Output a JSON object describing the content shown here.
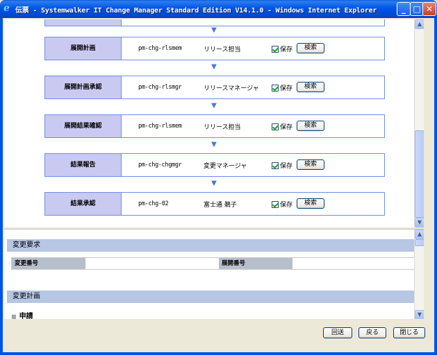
{
  "window": {
    "title": "伝票 - Systemwalker IT Change Manager Standard Edition V14.1.0 - Windows Internet Explorer",
    "controls": {
      "minimize": "_",
      "maximize": "□",
      "close": "✕"
    }
  },
  "workflow": {
    "arrow_glyph": "▼",
    "steps": [
      {
        "name": "展開計画",
        "role": "pm-chg-rlsmem",
        "person": "リリース担当",
        "save_label": "保存",
        "search_label": "検索"
      },
      {
        "name": "展開計画承認",
        "role": "pm-chg-rlsmgr",
        "person": "リリースマネージャ",
        "save_label": "保存",
        "search_label": "検索"
      },
      {
        "name": "展開結果確認",
        "role": "pm-chg-rlsmem",
        "person": "リリース担当",
        "save_label": "保存",
        "search_label": "検索"
      },
      {
        "name": "結果報告",
        "role": "pm-chg-chgmgr",
        "person": "変更マネージャ",
        "save_label": "保存",
        "search_label": "検索"
      },
      {
        "name": "結果承認",
        "role": "pm-chg-02",
        "person": "富士通 鵜子",
        "save_label": "保存",
        "search_label": "検索"
      }
    ]
  },
  "details": {
    "change_request_header": "変更要求",
    "change_number_label": "変更番号",
    "change_number_value": "",
    "deploy_number_label": "展開番号",
    "deploy_number_value": "",
    "change_plan_header": "変更計画",
    "application_subheader": "申請"
  },
  "footer": {
    "return_label": "回送",
    "back_label": "戻る",
    "close_label": "閉じる"
  },
  "colors": {
    "titlebar": "#0054E3",
    "step_header_bg": "#C9C9F2",
    "step_border": "#6C8FE3",
    "section_header_bg": "#B6C6E4",
    "info_label_bg": "#B7BFCB"
  }
}
